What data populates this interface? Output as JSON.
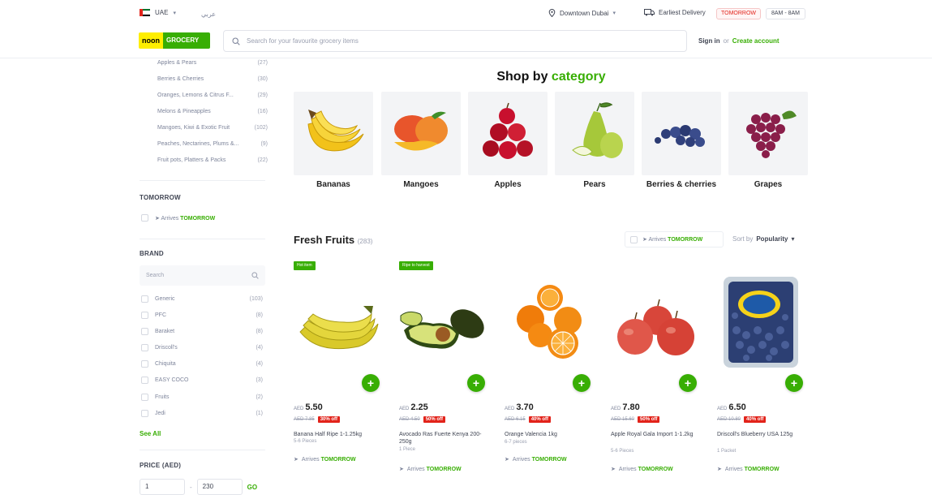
{
  "header": {
    "country": "UAE",
    "language": "عربي",
    "location": "Downtown Dubai",
    "delivery_label": "Earliest Delivery",
    "delivery_day": "TOMORROW",
    "delivery_time": "8AM - 8AM",
    "logo_noon": "noon",
    "logo_grocery": "GROCERY",
    "search_placeholder": "Search for your favourite grocery items",
    "sign_in": "Sign in",
    "or": "or",
    "create_account": "Create account"
  },
  "sidebar": {
    "subcategories": [
      {
        "label": "Apples & Pears",
        "count": "(27)"
      },
      {
        "label": "Berries & Cherries",
        "count": "(30)"
      },
      {
        "label": "Oranges, Lemons & Citrus F...",
        "count": "(29)"
      },
      {
        "label": "Melons & Pineapples",
        "count": "(16)"
      },
      {
        "label": "Mangoes, Kiwi & Exotic Fruit",
        "count": "(102)"
      },
      {
        "label": "Peaches, Nectarines, Plums &...",
        "count": "(9)"
      },
      {
        "label": "Fruit pots, Platters & Packs",
        "count": "(22)"
      }
    ],
    "tomorrow_title": "TOMORROW",
    "arrives_text": "Arrives",
    "arrives_day": "TOMORROW",
    "brand_title": "BRAND",
    "brand_search_placeholder": "Search",
    "brands": [
      {
        "label": "Generic",
        "count": "(103)"
      },
      {
        "label": "PFC",
        "count": "(8)"
      },
      {
        "label": "Baraket",
        "count": "(8)"
      },
      {
        "label": "Driscoll's",
        "count": "(4)"
      },
      {
        "label": "Chiquita",
        "count": "(4)"
      },
      {
        "label": "EASY COCO",
        "count": "(3)"
      },
      {
        "label": "Fruits",
        "count": "(2)"
      },
      {
        "label": "Jedi",
        "count": "(1)"
      }
    ],
    "see_all": "See All",
    "price_title": "PRICE (AED)",
    "price_min": "1",
    "price_sep": "-",
    "price_max": "230",
    "go": "GO"
  },
  "categories": {
    "title_main": "Shop by",
    "title_accent": "category",
    "items": [
      {
        "label": "Bananas"
      },
      {
        "label": "Mangoes"
      },
      {
        "label": "Apples"
      },
      {
        "label": "Pears"
      },
      {
        "label": "Berries & cherries"
      },
      {
        "label": "Grapes"
      }
    ]
  },
  "products_header": {
    "title": "Fresh Fruits",
    "count": "(283)",
    "arrives_text": "Arrives",
    "arrives_day": "TOMORROW",
    "sort_label": "Sort by",
    "sort_value": "Popularity"
  },
  "products": [
    {
      "tag": "Hot item",
      "currency": "AED",
      "price": "5.50",
      "old_price": "AED 7.85",
      "off": "30% off",
      "name": "Banana Half Ripe 1-1.25kg",
      "unit": "5-6 Pieces",
      "arrives_text": "Arrives",
      "arrives_day": "TOMORROW"
    },
    {
      "tag": "Ripe to harvest",
      "currency": "AED",
      "price": "2.25",
      "old_price": "AED 4.50",
      "off": "50% off",
      "name": "Avocado Ras Fuerte Kenya 200-250g",
      "unit": "1 Piece",
      "arrives_text": "Arrives",
      "arrives_day": "TOMORROW"
    },
    {
      "tag": "",
      "currency": "AED",
      "price": "3.70",
      "old_price": "AED 6.15",
      "off": "40% off",
      "name": "Orange Valencia 1kg",
      "unit": "6-7 pieces",
      "arrives_text": "Arrives",
      "arrives_day": "TOMORROW"
    },
    {
      "tag": "",
      "currency": "AED",
      "price": "7.80",
      "old_price": "AED 15.60",
      "off": "50% off",
      "name": "Apple Royal Gala Import 1-1.2kg",
      "unit": "5-6 Pieces",
      "arrives_text": "Arrives",
      "arrives_day": "TOMORROW"
    },
    {
      "tag": "",
      "currency": "AED",
      "price": "6.50",
      "old_price": "AED 10.80",
      "off": "40% off",
      "name": "Driscoll's Blueberry USA 125g",
      "unit": "1 Packet",
      "arrives_text": "Arrives",
      "arrives_day": "TOMORROW"
    }
  ],
  "colors": {
    "brand_green": "#38ae04",
    "brand_yellow": "#feee00",
    "discount_red": "#e2231a"
  }
}
